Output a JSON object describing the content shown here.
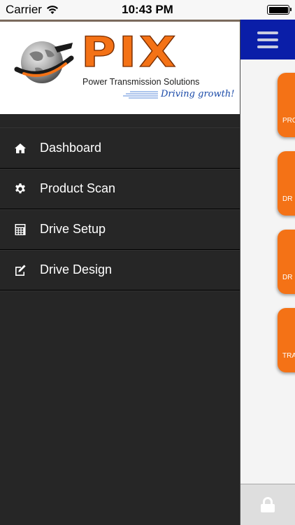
{
  "status_bar": {
    "carrier": "Carrier",
    "time": "10:43 PM"
  },
  "logo": {
    "brand": "PIX",
    "company": "Power Transmission Solutions",
    "tagline": "Driving growth!"
  },
  "menu": {
    "items": [
      {
        "label": "Dashboard",
        "icon": "home-icon"
      },
      {
        "label": "Product Scan",
        "icon": "gear-icon"
      },
      {
        "label": "Drive Setup",
        "icon": "calculator-icon"
      },
      {
        "label": "Drive Design",
        "icon": "edit-icon"
      }
    ]
  },
  "main": {
    "tiles": [
      {
        "label": "PRO"
      },
      {
        "label": "DR"
      },
      {
        "label": "DR"
      },
      {
        "label": "TRA"
      }
    ],
    "footer_icon": "lock-icon"
  },
  "colors": {
    "accent_orange": "#f47216",
    "header_blue": "#0a1ea8",
    "drawer_bg": "#262626"
  }
}
